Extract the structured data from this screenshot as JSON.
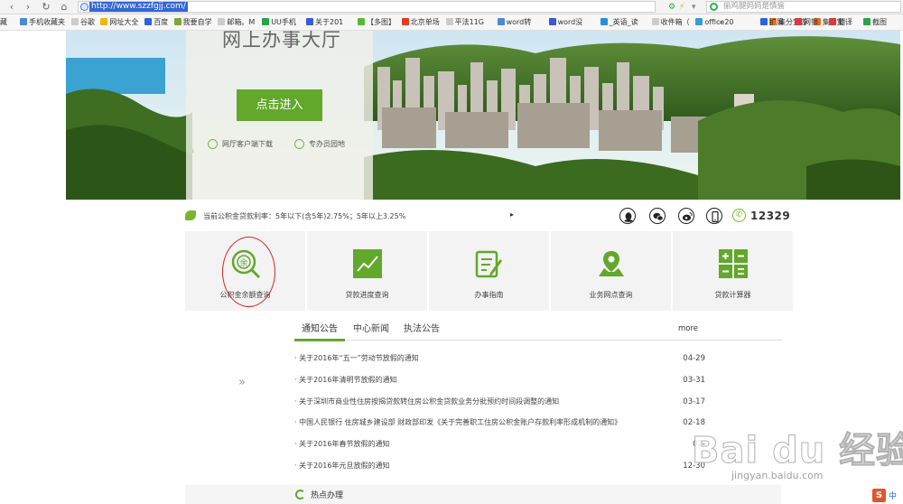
{
  "browser": {
    "url": "http://www.szzfgjj.com/",
    "search_placeholder": "偷鸡腿妈妈是慎偷",
    "favorites_cut": "藏",
    "favorites": [
      {
        "label": "手机收藏夹",
        "color": "#4a8ad8"
      },
      {
        "label": "谷歌",
        "color": "#cccccc"
      },
      {
        "label": "网址大全",
        "color": "#f2b705"
      },
      {
        "label": "百度",
        "color": "#2f62d8"
      },
      {
        "label": "我要自学",
        "color": "#7aa83b"
      },
      {
        "label": "邮箱。M",
        "color": "#cccccc"
      },
      {
        "label": "UU手机",
        "color": "#2aa34a"
      },
      {
        "label": "关于201",
        "color": "#3b5bd6"
      },
      {
        "label": "【多图】",
        "color": "#58b83a"
      },
      {
        "label": "北京单场",
        "color": "#e03c1f"
      },
      {
        "label": "平法11G",
        "color": "#cccccc"
      },
      {
        "label": "word转",
        "color": "#4a8ad8"
      },
      {
        "label": "word没",
        "color": "#3b5bd6"
      },
      {
        "label": "_英语_读",
        "color": "#2d8ed8"
      },
      {
        "label": "收件箱（",
        "color": "#cccccc"
      },
      {
        "label": "office20",
        "color": "#3b9ad8"
      },
      {
        "label": "集分宝游",
        "color": "#e76f1f"
      },
      {
        "label": "集分宝",
        "color": "#e76f1f"
      }
    ],
    "more_symbol": "»",
    "right_favorites": [
      {
        "label": "扩展",
        "color": "#2f62d8"
      },
      {
        "label": "网银",
        "color": "#d83b3b"
      },
      {
        "label": "翻译",
        "color": "#d83b3b"
      },
      {
        "label": "截图",
        "color": "#2aa34a"
      }
    ]
  },
  "banner": {
    "hall_title": "网上办事大厅",
    "enter_button": "点击进入",
    "links": [
      "网厅客户端下载",
      "专办员园地"
    ]
  },
  "info_bar": {
    "rate_text": "当前公积金贷款利率：5年以下(含5年)2.75%；5年以上3.25%",
    "arrow": "▸",
    "hotline": "12329",
    "socials": [
      "qq-icon",
      "wechat-icon",
      "weibo-icon",
      "mobile-icon"
    ]
  },
  "services": [
    {
      "label": "公积金余额查询",
      "icon": "balance-icon"
    },
    {
      "label": "贷款进度查询",
      "icon": "progress-chart-icon"
    },
    {
      "label": "办事指南",
      "icon": "guide-edit-icon"
    },
    {
      "label": "业务网点查询",
      "icon": "map-pin-icon"
    },
    {
      "label": "贷款计算器",
      "icon": "calculator-icon"
    }
  ],
  "news": {
    "tabs": [
      "通知公告",
      "中心新闻",
      "执法公告"
    ],
    "more": "more",
    "expand_symbol": "»",
    "items": [
      {
        "title": "· 关于2016年“五一”劳动节放假的通知",
        "date": "04-29"
      },
      {
        "title": "· 关于2016年清明节放假的通知",
        "date": "03-31"
      },
      {
        "title": "· 关于深圳市商业性住房按揭贷款转住房公积金贷款业务分批预约时间段调整的通知",
        "date": "03-17"
      },
      {
        "title": "· 中国人民银行 住房城乡建设部 财政部印发《关于完善职工住房公积金账户存款利率形成机制的通知》",
        "date": "02-18"
      },
      {
        "title": "· 关于2016年春节放假的通知",
        "date": "02-"
      },
      {
        "title": "· 关于2016年元旦放假的通知",
        "date": "12-30"
      }
    ]
  },
  "hot": {
    "label": "热点办理"
  },
  "watermark": {
    "brand": "Bai du 经验",
    "url": "jingyan.baidu.com"
  },
  "ime": {
    "logo": "S",
    "label": "中"
  },
  "colors": {
    "brand_green": "#62a82b",
    "highlight_red": "#d9262a"
  }
}
